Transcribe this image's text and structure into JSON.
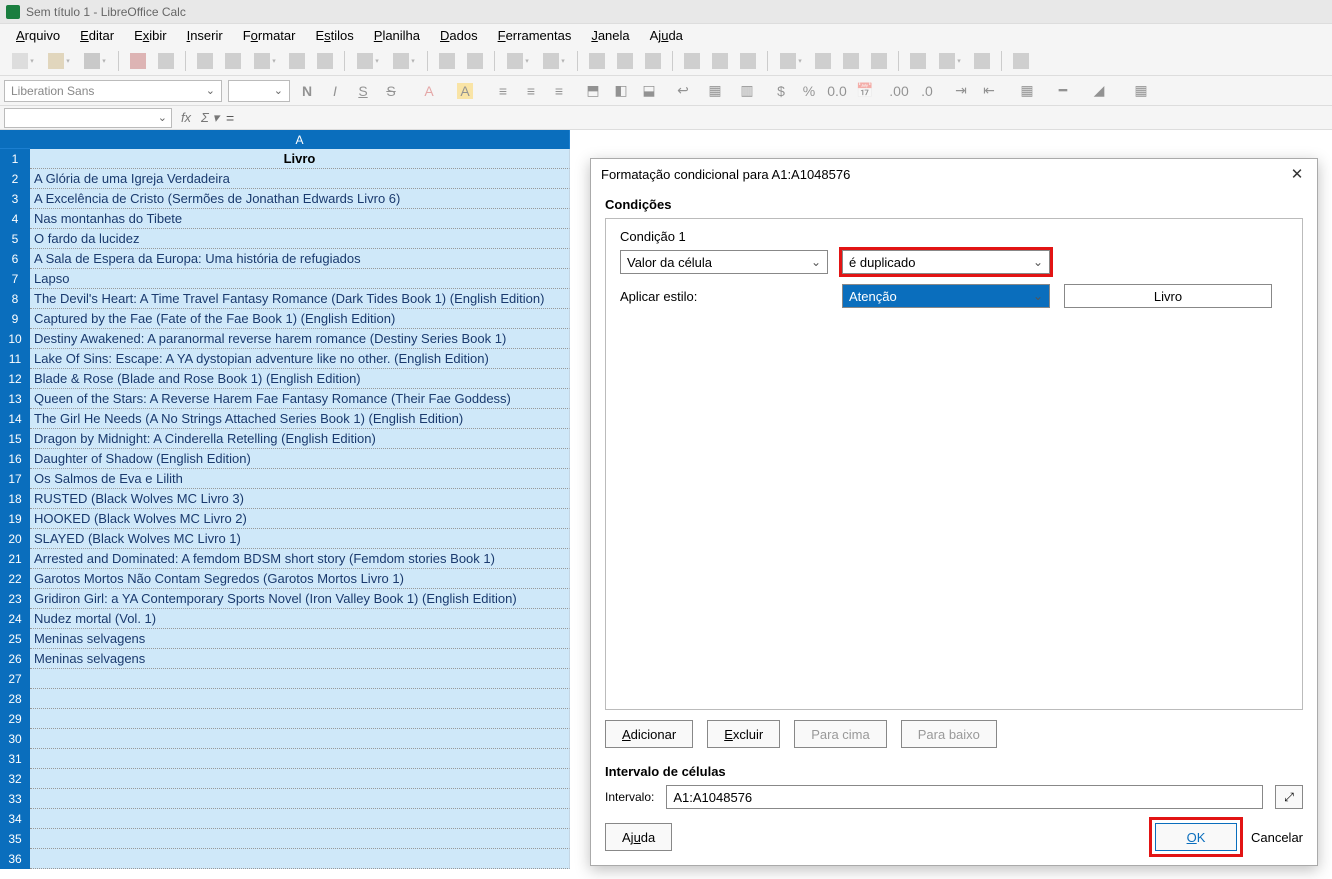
{
  "title": "Sem título 1 - LibreOffice Calc",
  "menus": [
    "Arquivo",
    "Editar",
    "Exibir",
    "Inserir",
    "Formatar",
    "Estilos",
    "Planilha",
    "Dados",
    "Ferramentas",
    "Janela",
    "Ajuda"
  ],
  "menu_underline_idx": [
    0,
    0,
    1,
    0,
    1,
    1,
    0,
    0,
    0,
    0,
    2
  ],
  "font_name": "Liberation Sans",
  "font_size": "",
  "column_header": "A",
  "header_cell": "Livro",
  "rows": [
    "A Glória de uma Igreja Verdadeira",
    "A Excelência de Cristo (Sermões de Jonathan Edwards Livro 6)",
    "Nas montanhas do Tibete",
    "O fardo da lucidez",
    "A Sala de Espera da Europa: Uma história de refugiados",
    "Lapso",
    "The Devil's Heart: A Time Travel Fantasy Romance (Dark Tides Book 1) (English Edition)",
    "Captured by the Fae (Fate of the Fae Book 1) (English Edition)",
    "Destiny Awakened: A paranormal reverse harem romance (Destiny Series Book 1)",
    "Lake Of Sins: Escape: A YA dystopian adventure like no other. (English Edition)",
    "Blade & Rose (Blade and Rose Book 1) (English Edition)",
    "Queen of the Stars: A Reverse Harem Fae Fantasy Romance (Their Fae Goddess)",
    "The Girl He Needs (A No Strings Attached Series Book 1) (English Edition)",
    "Dragon by Midnight: A Cinderella Retelling (English Edition)",
    "Daughter of Shadow (English Edition)",
    "Os Salmos de Eva e Lilith",
    "RUSTED (Black Wolves MC Livro 3)",
    "HOOKED (Black Wolves MC Livro 2)",
    "SLAYED (Black Wolves MC Livro 1)",
    "Arrested and Dominated: A femdom BDSM short story (Femdom stories Book 1)",
    "Garotos Mortos Não Contam Segredos (Garotos Mortos Livro 1)",
    "Gridiron Girl: a YA Contemporary Sports Novel (Iron Valley Book 1) (English Edition)",
    "Nudez mortal (Vol. 1)",
    "Meninas selvagens",
    "Meninas selvagens",
    "",
    "",
    "",
    "",
    "",
    "",
    "",
    "",
    "",
    ""
  ],
  "dialog": {
    "title": "Formatação condicional para A1:A1048576",
    "conditions_label": "Condições",
    "cond1_label": "Condição 1",
    "value_type": "Valor da célula",
    "operator": "é duplicado",
    "apply_style_label": "Aplicar estilo:",
    "style_value": "Atenção",
    "preview_text": "Livro",
    "btn_add": "Adicionar",
    "btn_remove": "Excluir",
    "btn_up": "Para cima",
    "btn_down": "Para baixo",
    "interval_section": "Intervalo de células",
    "interval_label": "Intervalo:",
    "interval_value": "A1:A1048576",
    "btn_help": "Ajuda",
    "btn_ok": "OK",
    "btn_cancel": "Cancelar"
  }
}
